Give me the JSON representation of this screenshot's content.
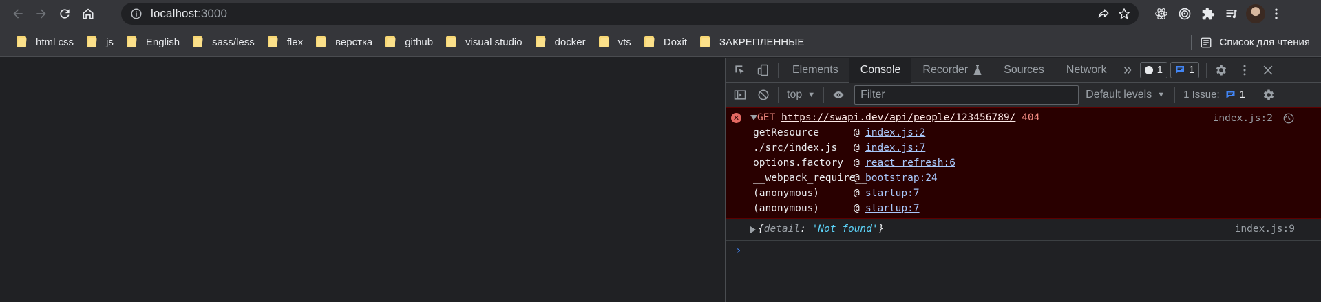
{
  "browser": {
    "url_host": "localhost",
    "url_port": ":3000",
    "bookmarks": [
      "html css",
      "js",
      "English",
      "sass/less",
      "flex",
      "верстка",
      "github",
      "visual studio",
      "docker",
      "vts",
      "Doxit",
      "ЗАКРЕПЛЕННЫЕ"
    ],
    "reading_list_label": "Список для чтения"
  },
  "devtools": {
    "tabs": [
      "Elements",
      "Console",
      "Recorder",
      "Sources",
      "Network"
    ],
    "active_tab": "Console",
    "error_count": "1",
    "message_count": "1",
    "context": "top",
    "filter_placeholder": "Filter",
    "levels_label": "Default levels",
    "issues_label": "1 Issue:",
    "issues_count": "1"
  },
  "console": {
    "error": {
      "method": "GET",
      "url": "https://swapi.dev/api/people/123456789/",
      "status": "404",
      "source": "index.js:2",
      "stack": [
        {
          "fn": "getResource",
          "loc": "index.js:2"
        },
        {
          "fn": "./src/index.js",
          "loc": "index.js:7"
        },
        {
          "fn": "options.factory",
          "loc": "react refresh:6"
        },
        {
          "fn": "__webpack_require__",
          "loc": "bootstrap:24"
        },
        {
          "fn": "(anonymous)",
          "loc": "startup:7"
        },
        {
          "fn": "(anonymous)",
          "loc": "startup:7"
        }
      ]
    },
    "log": {
      "open": "{",
      "key": "detail",
      "colon": ": ",
      "value": "'Not found'",
      "close": "}",
      "source": "index.js:9"
    },
    "prompt": "›"
  }
}
